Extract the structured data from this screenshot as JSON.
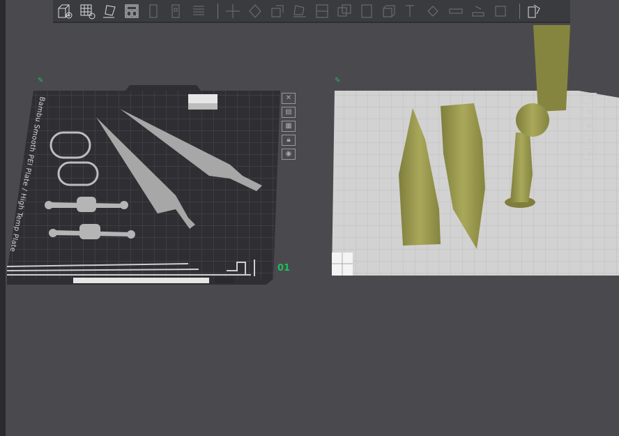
{
  "toolbar": {
    "icons": [
      "add-object-icon",
      "add-plate-icon",
      "auto-orient-icon",
      "arrange-icon",
      "orient-icon",
      "place-icon",
      "layers-icon",
      "move-icon",
      "rotate-icon",
      "scale-icon",
      "lay-on-face-icon",
      "cut-icon",
      "boolean-icon",
      "support-paint-icon",
      "assembly-icon",
      "text-icon",
      "color-paint-icon",
      "measure-icon",
      "seam-icon",
      "fullscreen-icon",
      "split-icon"
    ]
  },
  "plates": [
    {
      "number": "01",
      "bed_text": "Bambu Smooth PEI Plate / High Temp Plate",
      "selected": true,
      "buttons": [
        "close",
        "arrange",
        "orient",
        "lock",
        "view"
      ]
    },
    {
      "number": "",
      "selected": false,
      "buttons": [
        "close",
        "arrange",
        "orient",
        "lock",
        "view"
      ]
    }
  ],
  "colors": {
    "background": "#4a4a4e",
    "accent": "#1fbe5b",
    "filament": "#9b9a4e",
    "dark_plate": "#2f2f33",
    "light_plate": "#d2d2d2"
  }
}
